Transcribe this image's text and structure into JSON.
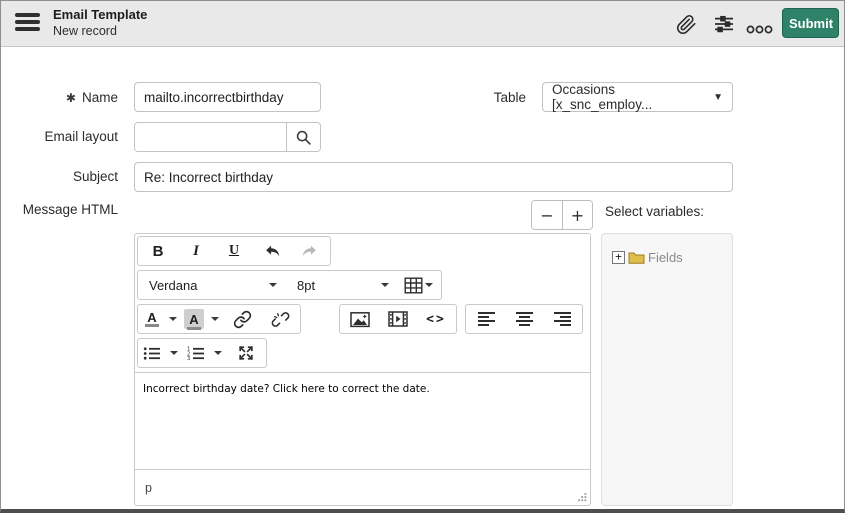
{
  "colors": {
    "accent": "#2e8268",
    "folder_fill": "#dfbe4e",
    "header_bg": "#e9e9e9"
  },
  "header": {
    "title": "Email Template",
    "subtitle": "New record",
    "submit_label": "Submit"
  },
  "form": {
    "name": {
      "label": "Name",
      "required_marker": "✱",
      "value": "mailto.incorrectbirthday"
    },
    "table": {
      "label": "Table",
      "value": "Occasions [x_snc_employ..."
    },
    "email_layout": {
      "label": "Email layout",
      "value": ""
    },
    "subject": {
      "label": "Subject",
      "value": "Re: Incorrect birthday"
    },
    "message_html_label": "Message HTML",
    "zoom_out_label": "−",
    "zoom_in_label": "+",
    "select_variables_label": "Select variables:"
  },
  "editor": {
    "toolbar": {
      "bold": "B",
      "italic": "I",
      "underline": "U",
      "font_family": "Verdana",
      "font_size": "8pt",
      "color_letter": "A",
      "background_letter": "A",
      "code_glyph": "<>"
    },
    "content_text": "Incorrect birthday date? Click here to correct the date.",
    "status_path": "p"
  },
  "variables_panel": {
    "items": [
      {
        "label": "Fields"
      }
    ]
  }
}
